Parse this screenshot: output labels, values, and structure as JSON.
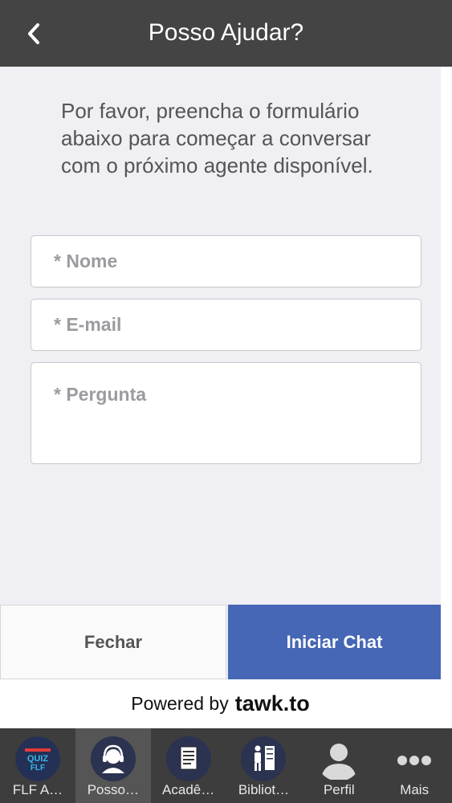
{
  "header": {
    "title": "Posso Ajudar?"
  },
  "intro_text": "Por favor, preencha o formulário abaixo para começar a conversar com o próximo agente disponível.",
  "form": {
    "name_placeholder": "* Nome",
    "email_placeholder": "* E-mail",
    "question_placeholder": "* Pergunta"
  },
  "actions": {
    "close_label": "Fechar",
    "start_label": "Iniciar Chat"
  },
  "powered": {
    "text": "Powered by",
    "brand": "tawk.to"
  },
  "tabs": [
    {
      "label": "FLF A…",
      "icon": "quiz-icon"
    },
    {
      "label": "Posso…",
      "icon": "headset-icon"
    },
    {
      "label": "Acadê…",
      "icon": "document-icon"
    },
    {
      "label": "Bibliot…",
      "icon": "library-icon"
    },
    {
      "label": "Perfil",
      "icon": "user-icon"
    },
    {
      "label": "Mais",
      "icon": "more-icon"
    }
  ],
  "colors": {
    "header": "#444444",
    "accent": "#4667b5",
    "tabbar": "#3d3d3d"
  }
}
